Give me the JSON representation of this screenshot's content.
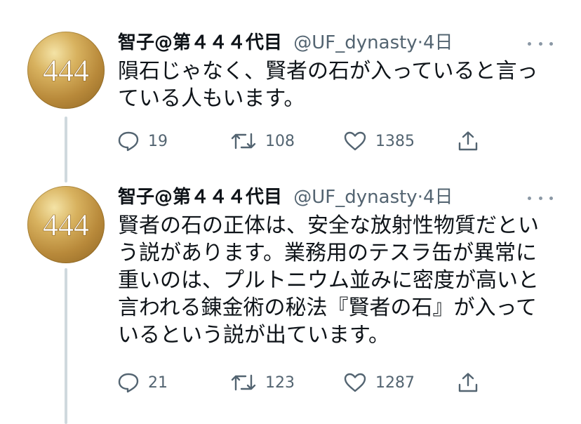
{
  "icons": {
    "avatar": "gold-444-avatar",
    "reply": "reply-icon",
    "retweet": "retweet-icon",
    "like": "heart-icon",
    "share": "share-icon",
    "more": "more-dots-icon"
  },
  "colors": {
    "muted": "#536471",
    "thread_line": "#cfd9de",
    "avatar_gold": "#c9a04e"
  },
  "tweets": [
    {
      "avatar_text": "444",
      "name": "智子@第４４４代目",
      "handle": "@UF_dynasty",
      "separator": "·",
      "time": "4日",
      "lines": [
        "隕石じゃなく、賢者の石が入っていると言っ",
        "ている人もいます。"
      ],
      "replies": "19",
      "retweets": "108",
      "likes": "1385"
    },
    {
      "avatar_text": "444",
      "name": "智子@第４４４代目",
      "handle": "@UF_dynasty",
      "separator": "·",
      "time": "4日",
      "lines": [
        "賢者の石の正体は、安全な放射性物質だとい",
        "う説があります。業務用のテスラ缶が異常に",
        "重いのは、プルトニウム並みに密度が高いと",
        "言われる錬金術の秘法『賢者の石』が入って",
        "いるという説が出ています。"
      ],
      "replies": "21",
      "retweets": "123",
      "likes": "1287"
    }
  ]
}
